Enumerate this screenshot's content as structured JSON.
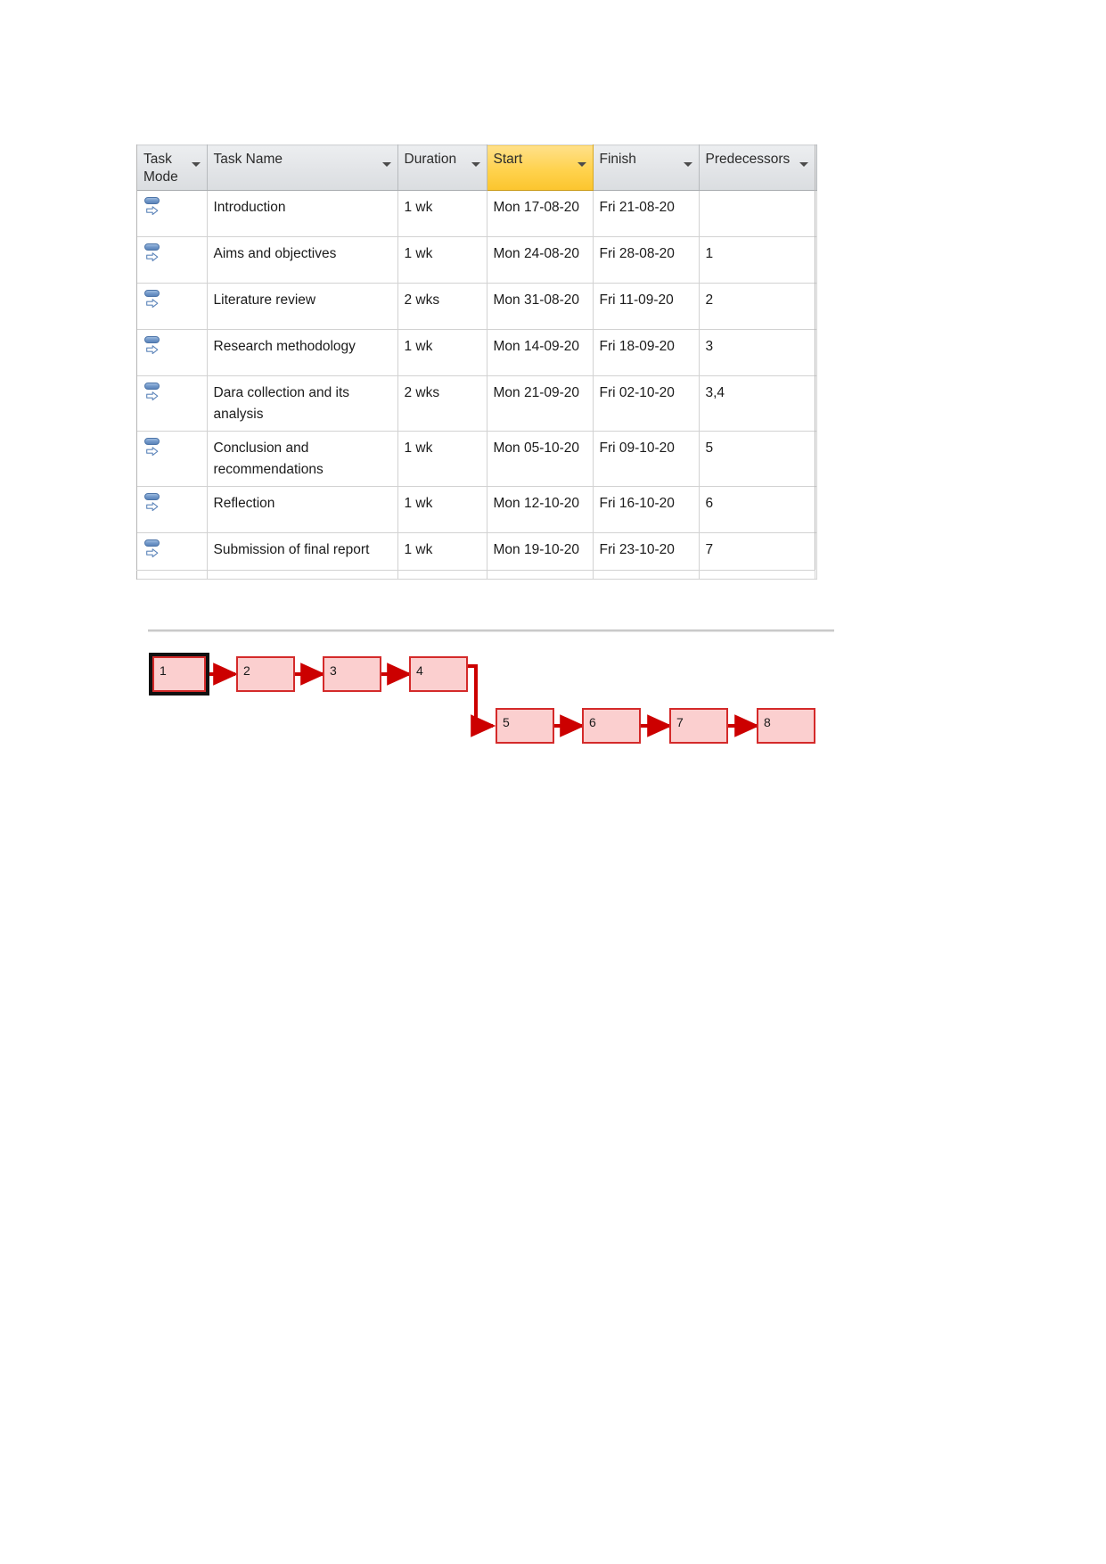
{
  "sheet": {
    "columns": [
      {
        "key": "mode",
        "label": "Task\nMode",
        "label_line1": "Task",
        "label_line2": "Mode",
        "has_filter": true,
        "highlighted": false
      },
      {
        "key": "name",
        "label": "Task Name",
        "has_filter": true,
        "highlighted": false
      },
      {
        "key": "duration",
        "label": "Duration",
        "has_filter": true,
        "highlighted": false
      },
      {
        "key": "start",
        "label": "Start",
        "has_filter": true,
        "highlighted": true
      },
      {
        "key": "finish",
        "label": "Finish",
        "has_filter": true,
        "highlighted": false
      },
      {
        "key": "predecessors",
        "label": "Predecessors",
        "has_filter": true,
        "highlighted": false
      },
      {
        "key": "clipped",
        "label": "",
        "has_filter": false,
        "highlighted": false
      }
    ],
    "header": {
      "task_mode_line1": "Task",
      "task_mode_line2": "Mode",
      "task_name": "Task Name",
      "duration": "Duration",
      "start": "Start",
      "finish": "Finish",
      "predecessors": "Predecessors"
    },
    "mode_icon": "auto-schedule-icon",
    "rows": [
      {
        "id": 1,
        "mode_icon": "auto-schedule-icon",
        "name": "Introduction",
        "duration": "1 wk",
        "start": "Mon 17-08-20",
        "finish": "Fri 21-08-20",
        "predecessors": ""
      },
      {
        "id": 2,
        "mode_icon": "auto-schedule-icon",
        "name": "Aims and objectives",
        "duration": "1 wk",
        "start": "Mon 24-08-20",
        "finish": "Fri 28-08-20",
        "predecessors": "1"
      },
      {
        "id": 3,
        "mode_icon": "auto-schedule-icon",
        "name": "Literature review",
        "duration": "2 wks",
        "start": "Mon 31-08-20",
        "finish": "Fri 11-09-20",
        "predecessors": "2"
      },
      {
        "id": 4,
        "mode_icon": "auto-schedule-icon",
        "name": "Research methodology",
        "duration": "1 wk",
        "start": "Mon 14-09-20",
        "finish": "Fri 18-09-20",
        "predecessors": "3"
      },
      {
        "id": 5,
        "mode_icon": "auto-schedule-icon",
        "name": "Dara collection and its analysis",
        "duration": "2 wks",
        "start": "Mon 21-09-20",
        "finish": "Fri 02-10-20",
        "predecessors": "3,4"
      },
      {
        "id": 6,
        "mode_icon": "auto-schedule-icon",
        "name": "Conclusion and recommendations",
        "duration": "1 wk",
        "start": "Mon 05-10-20",
        "finish": "Fri 09-10-20",
        "predecessors": "5"
      },
      {
        "id": 7,
        "mode_icon": "auto-schedule-icon",
        "name": "Reflection",
        "duration": "1 wk",
        "start": "Mon 12-10-20",
        "finish": "Fri 16-10-20",
        "predecessors": "6"
      },
      {
        "id": 8,
        "mode_icon": "auto-schedule-icon",
        "name": "Submission of final report",
        "duration": "1 wk",
        "start": "Mon 19-10-20",
        "finish": "Fri 23-10-20",
        "predecessors": "7"
      }
    ]
  },
  "network": {
    "nodes": [
      {
        "id": "1",
        "label": "1",
        "selected": true
      },
      {
        "id": "2",
        "label": "2",
        "selected": false
      },
      {
        "id": "3",
        "label": "3",
        "selected": false
      },
      {
        "id": "4",
        "label": "4",
        "selected": false
      },
      {
        "id": "5",
        "label": "5",
        "selected": false
      },
      {
        "id": "6",
        "label": "6",
        "selected": false
      },
      {
        "id": "7",
        "label": "7",
        "selected": false
      },
      {
        "id": "8",
        "label": "8",
        "selected": false
      }
    ],
    "links": [
      "1->2",
      "2->3",
      "3->4",
      "4->5",
      "5->6",
      "6->7",
      "7->8"
    ]
  },
  "colors": {
    "header_background": "#e3e5e8",
    "start_header_highlight": "#ffd24d",
    "node_fill": "#fbcfcf",
    "node_border": "#d42a2a",
    "link_arrow": "#cc0000",
    "mode_icon_blue": "#6f96c8",
    "selection_border": "#111111"
  }
}
